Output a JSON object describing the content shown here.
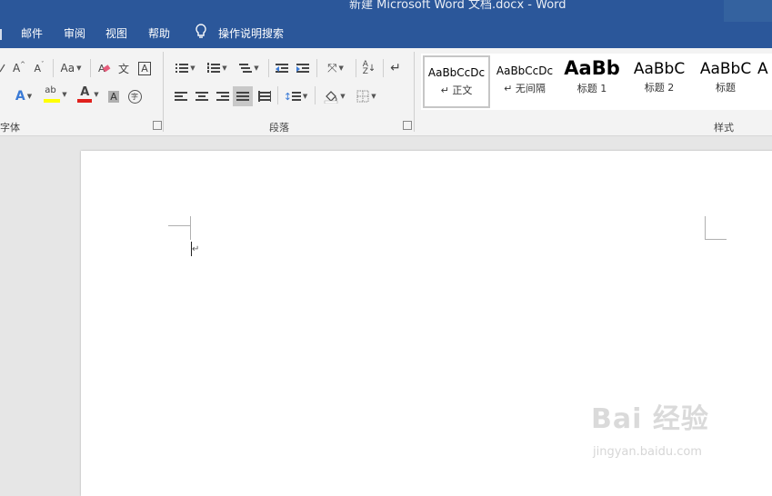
{
  "window": {
    "title": "新建 Microsoft Word 文档.docx  -  Word"
  },
  "tabs": [
    {
      "label": "邮件"
    },
    {
      "label": "审阅"
    },
    {
      "label": "视图"
    },
    {
      "label": "帮助"
    }
  ],
  "tell_me": {
    "label": "操作说明搜索",
    "icon": "lightbulb-icon"
  },
  "ribbon": {
    "font_group": {
      "label": "字体"
    },
    "paragraph_group": {
      "label": "段落"
    },
    "styles_group": {
      "label": "样式"
    },
    "font_buttons": {
      "grow": "A",
      "shrink": "A",
      "case": "Aa",
      "phonetic": "文",
      "border": "A",
      "effects": "A",
      "highlight": "ab",
      "color": "A",
      "shading": "A",
      "enclose": "字"
    }
  },
  "styles": [
    {
      "sample": "AaBbCcDc",
      "name": "正文",
      "prefix": "↵"
    },
    {
      "sample": "AaBbCcDc",
      "name": "无间隔",
      "prefix": "↵"
    },
    {
      "sample": "AaBb",
      "name": "标题 1"
    },
    {
      "sample": "AaBbC",
      "name": "标题 2"
    },
    {
      "sample": "AaBbC",
      "name": "标题"
    },
    {
      "sample": "A",
      "name": ""
    }
  ],
  "document": {
    "paragraph_mark": "↵"
  },
  "watermark": {
    "logo": "Bai  经验",
    "site": "jingyan.baidu.com"
  },
  "colors": {
    "titlebar": "#2b579a",
    "ribbon": "#f3f3f3",
    "highlight_yellow": "#ffff00",
    "font_red": "#e0201c"
  }
}
